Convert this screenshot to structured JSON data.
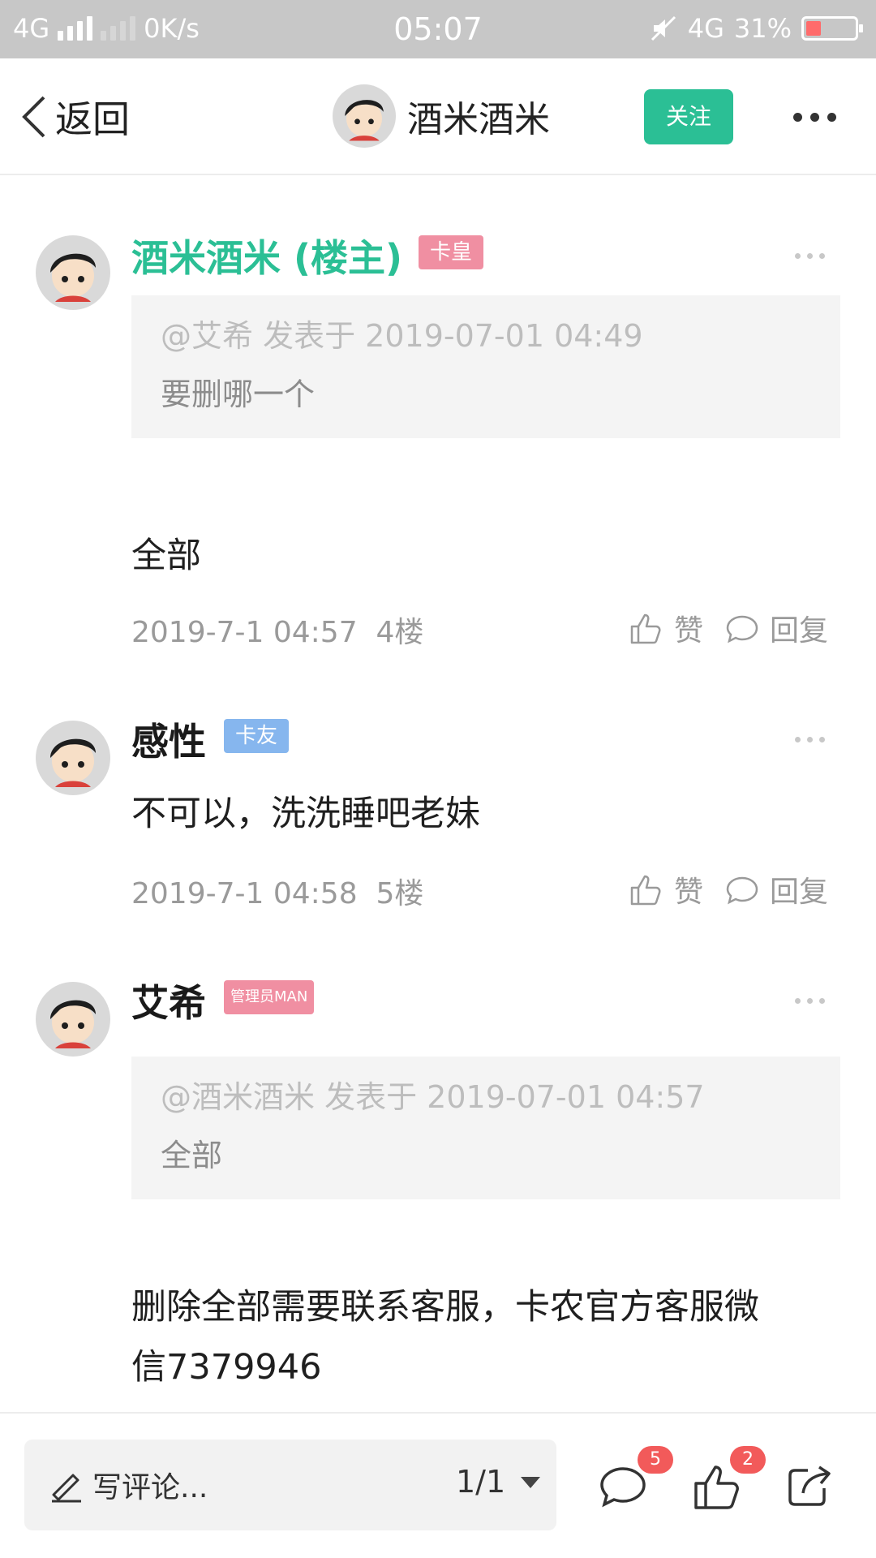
{
  "status_bar": {
    "network_left": "4G",
    "speed": "0K/s",
    "time": "05:07",
    "network_right": "4G",
    "battery": "31%",
    "battery_level": 0.31
  },
  "header": {
    "back_label": "返回",
    "author_name": "酒米酒米",
    "follow_label": "关注",
    "more_icon": "more-icon"
  },
  "posts": [
    {
      "username": "酒米酒米 (楼主)",
      "badge": "卡皇",
      "quote": {
        "head": "@艾希 发表于 2019-07-01 04:49",
        "body": "要删哪一个"
      },
      "text": "全部",
      "timestamp": "2019-7-1 04:57",
      "floor": "4楼",
      "like_label": "赞",
      "reply_label": "回复"
    },
    {
      "username": "感性",
      "badge": "卡友",
      "text": "不可以，洗洗睡吧老妹",
      "timestamp": "2019-7-1 04:58",
      "floor": "5楼",
      "like_label": "赞",
      "reply_label": "回复"
    },
    {
      "username": "艾希",
      "badge": "管理员MAN",
      "quote": {
        "head": "@酒米酒米 发表于 2019-07-01 04:57",
        "body": "全部"
      },
      "text_line1": "删除全部需要联系客服，卡农官方客服微",
      "text_line2": "信7379946"
    }
  ],
  "bottom_bar": {
    "comment_placeholder": "写评论...",
    "page_indicator": "1/1",
    "comment_count": "5",
    "like_count": "2"
  },
  "colors": {
    "accent": "#2bbf95",
    "badge_pink": "#f08fa2",
    "badge_blue": "#86b6ee",
    "count_badge": "#f25a5a"
  }
}
